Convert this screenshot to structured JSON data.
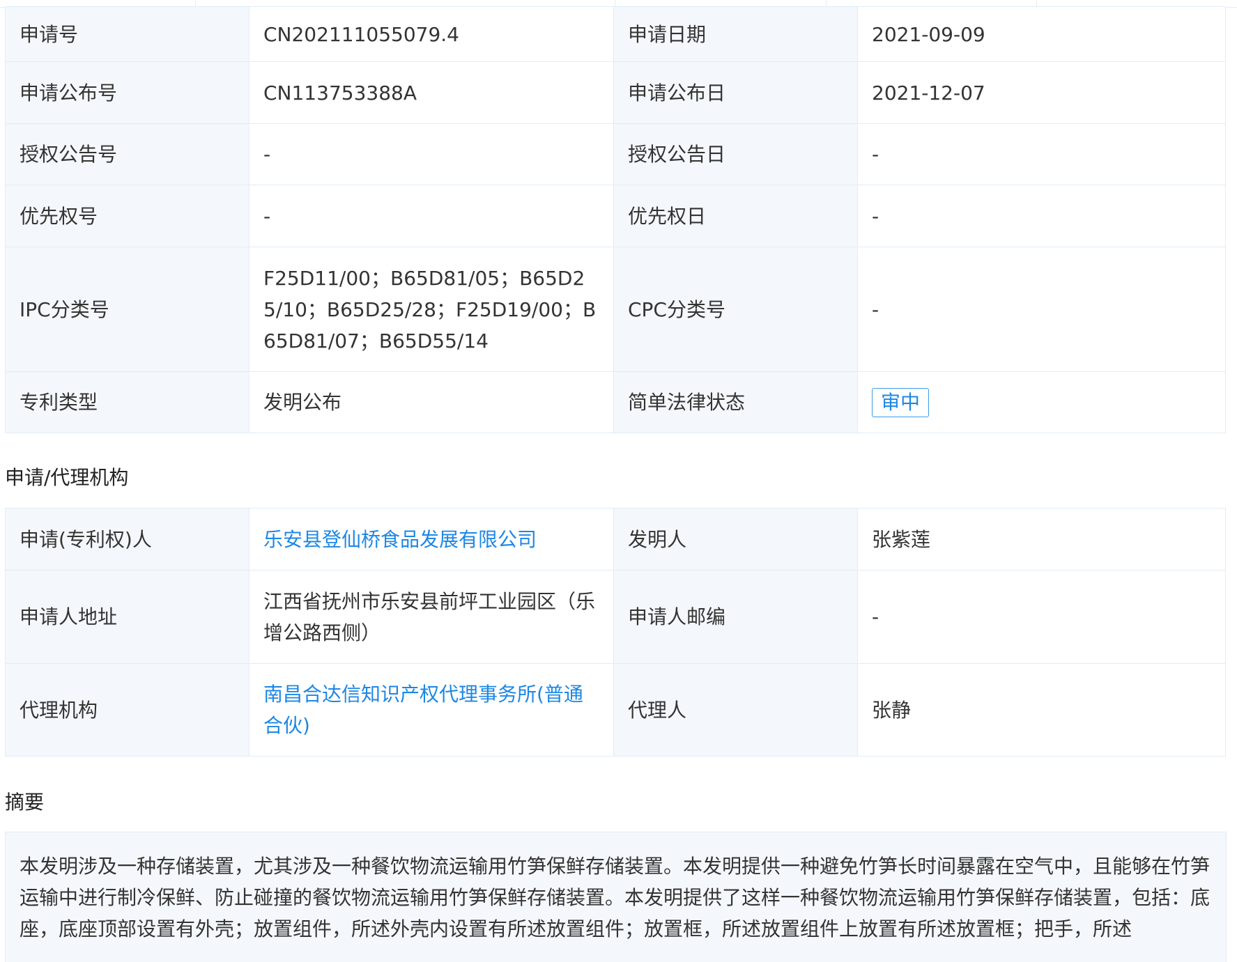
{
  "basic_info": {
    "rows": [
      {
        "l1": "申请号",
        "v1": "CN202111055079.4",
        "l2": "申请日期",
        "v2": "2021-09-09"
      },
      {
        "l1": "申请公布号",
        "v1": "CN113753388A",
        "l2": "申请公布日",
        "v2": "2021-12-07"
      },
      {
        "l1": "授权公告号",
        "v1": "-",
        "l2": "授权公告日",
        "v2": "-"
      },
      {
        "l1": "优先权号",
        "v1": "-",
        "l2": "优先权日",
        "v2": "-"
      },
      {
        "l1": "IPC分类号",
        "v1": "F25D11/00；B65D81/05；B65D25/10；B65D25/28；F25D19/00；B65D81/07；B65D55/14",
        "l2": "CPC分类号",
        "v2": "-"
      },
      {
        "l1": "专利类型",
        "v1": "发明公布",
        "l2": "简单法律状态",
        "v2": "审中"
      }
    ]
  },
  "agency": {
    "title": "申请/代理机构",
    "rows": [
      {
        "l1": "申请(专利权)人",
        "v1": "乐安县登仙桥食品发展有限公司",
        "l2": "发明人",
        "v2": "张紫莲"
      },
      {
        "l1": "申请人地址",
        "v1": "江西省抚州市乐安县前坪工业园区（乐增公路西侧）",
        "l2": "申请人邮编",
        "v2": "-"
      },
      {
        "l1": "代理机构",
        "v1": "南昌合达信知识产权代理事务所(普通合伙)",
        "l2": "代理人",
        "v2": "张静"
      }
    ]
  },
  "abstract": {
    "title": "摘要",
    "text": "本发明涉及一种存储装置，尤其涉及一种餐饮物流运输用竹笋保鲜存储装置。本发明提供一种避免竹笋长时间暴露在空气中，且能够在竹笋运输中进行制冷保鲜、防止碰撞的餐饮物流运输用竹笋保鲜存储装置。本发明提供了这样一种餐饮物流运输用竹笋保鲜存储装置，包括：底座，底座顶部设置有外壳；放置组件，所述外壳内设置有所述放置组件；放置框，所述放置组件上放置有所述放置框；把手，所述"
  },
  "colors": {
    "link": "#1d87e5",
    "label_bg": "#f4f8fc",
    "border": "#e1ecf6"
  }
}
